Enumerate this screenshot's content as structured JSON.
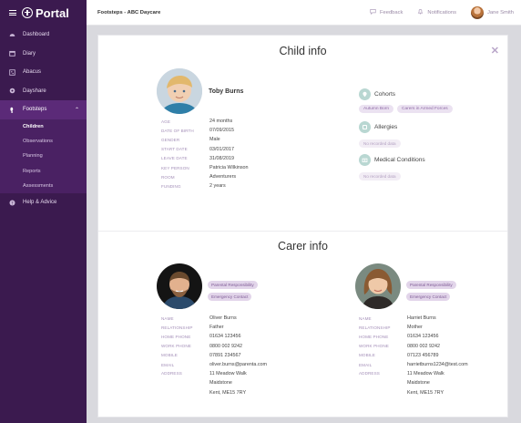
{
  "app": {
    "brand": "Portal"
  },
  "sidebar": {
    "items": [
      {
        "label": "Dashboard",
        "icon": "dashboard-icon"
      },
      {
        "label": "Diary",
        "icon": "calendar-icon"
      },
      {
        "label": "Abacus",
        "icon": "abacus-icon"
      },
      {
        "label": "Dayshare",
        "icon": "dayshare-icon"
      },
      {
        "label": "Footsteps",
        "icon": "footsteps-icon",
        "active": true
      },
      {
        "label": "Help & Advice",
        "icon": "help-icon"
      }
    ],
    "sub_items": [
      "Children",
      "Observations",
      "Planning",
      "Reports",
      "Assessments"
    ]
  },
  "topbar": {
    "breadcrumb": "Footsteps - ABC Daycare",
    "feedback": "Feedback",
    "notifications": "Notifications",
    "user": "Jane Smith"
  },
  "child": {
    "title": "Child info",
    "name": "Toby Burns",
    "fields": [
      {
        "k": "AGE",
        "v": "24 months"
      },
      {
        "k": "DATE OF BIRTH",
        "v": "07/09/2015"
      },
      {
        "k": "GENDER",
        "v": "Male"
      },
      {
        "k": "START DATE",
        "v": "03/01/2017"
      },
      {
        "k": "LEAVE DATE",
        "v": "31/08/2019"
      },
      {
        "k": "KEY PERSON",
        "v": "Patricia Wilkinson"
      },
      {
        "k": "ROOM",
        "v": "Adventurers"
      },
      {
        "k": "FUNDING",
        "v": "2 years"
      }
    ],
    "cohorts": {
      "label": "Cohorts",
      "tags": [
        "Autumn Born",
        "Carers in Armed Forces"
      ]
    },
    "allergies": {
      "label": "Allergies",
      "empty": "No recorded data"
    },
    "medical": {
      "label": "Medical Conditions",
      "empty": "No recorded data"
    }
  },
  "carers": {
    "title": "Carer info",
    "list": [
      {
        "tags": [
          "Parental Responsibility",
          "Emergency Contact"
        ],
        "fields": [
          {
            "k": "NAME",
            "v": "Oliver Burns"
          },
          {
            "k": "RELATIONSHIP",
            "v": "Father"
          },
          {
            "k": "HOME PHONE",
            "v": "01634 123456"
          },
          {
            "k": "WORK PHONE",
            "v": "0800 002 9242"
          },
          {
            "k": "MOBILE",
            "v": "07891 234567"
          },
          {
            "k": "EMAIL",
            "v": "oliver.burns@parenta.com"
          }
        ],
        "address_label": "ADDRESS",
        "address": [
          "11 Meadow Walk",
          "Maidstone",
          "Kent, ME15 7RY"
        ]
      },
      {
        "tags": [
          "Parental Responsibility",
          "Emergency Contact"
        ],
        "fields": [
          {
            "k": "NAME",
            "v": "Harriet Burns"
          },
          {
            "k": "RELATIONSHIP",
            "v": "Mother"
          },
          {
            "k": "HOME PHONE",
            "v": "01634 123456"
          },
          {
            "k": "WORK PHONE",
            "v": "0800 002 9242"
          },
          {
            "k": "MOBILE",
            "v": "07123 456789"
          },
          {
            "k": "EMAIL",
            "v": "harrietburns1234@test.com"
          }
        ],
        "address_label": "ADDRESS",
        "address": [
          "11 Meadow Walk",
          "Maidstone",
          "Kent, ME15 7RY"
        ]
      }
    ]
  },
  "colors": {
    "sidebar": "#3b1a4f",
    "active": "#5b2a78",
    "accent": "#a48fb8",
    "teal": "#b9d7d2"
  }
}
